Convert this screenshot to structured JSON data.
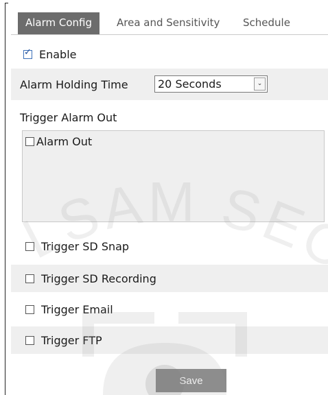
{
  "tabs": [
    {
      "label": "Alarm Config",
      "active": true
    },
    {
      "label": "Area and Sensitivity",
      "active": false
    },
    {
      "label": "Schedule",
      "active": false
    }
  ],
  "enable": {
    "label": "Enable",
    "checked": true
  },
  "holding_time": {
    "label": "Alarm Holding Time",
    "value": "20 Seconds"
  },
  "trigger_alarm_out": {
    "label": "Trigger Alarm Out",
    "items": [
      {
        "label": "Alarm Out",
        "checked": false
      }
    ]
  },
  "triggers": {
    "sd_snap": {
      "label": "Trigger SD Snap",
      "checked": false
    },
    "sd_recording": {
      "label": "Trigger SD Recording",
      "checked": false
    },
    "email": {
      "label": "Trigger Email",
      "checked": false
    },
    "ftp": {
      "label": "Trigger FTP",
      "checked": false
    }
  },
  "save_label": "Save",
  "watermark_text": "LSAM SECU",
  "colors": {
    "active_tab": "#6c6c6c",
    "shaded_row": "#efefef",
    "save_button": "#8b8b8b"
  }
}
